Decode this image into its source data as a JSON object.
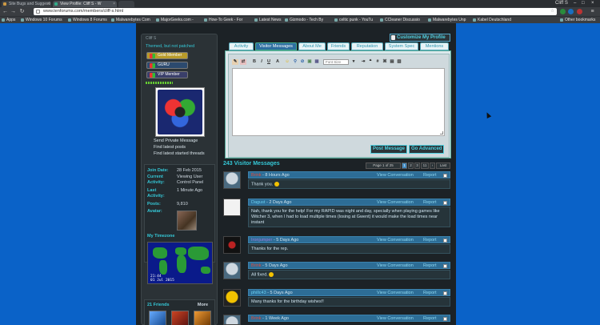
{
  "browser": {
    "tabs": [
      {
        "label": "Site Bugs and Suggesti"
      },
      {
        "label": "View Profile: Cliff S - W"
      },
      {
        "label": ""
      }
    ],
    "window_controls": "Cliff S",
    "url": "www.tenforums.com/members/cliff-s.html",
    "bookmarks": [
      {
        "label": "Apps"
      },
      {
        "label": "Windows 10 Forums"
      },
      {
        "label": "Windows 8 Forums"
      },
      {
        "label": "Malwarebytes Com"
      },
      {
        "label": "MajorGeeks.com -"
      },
      {
        "label": "How-To Geek - For"
      },
      {
        "label": "Latest News"
      },
      {
        "label": "Gizmodo - Tech By"
      },
      {
        "label": "celtic punk - YouTu"
      },
      {
        "label": "CCleaner Discussio"
      },
      {
        "label": "Malwarebytes Unp"
      },
      {
        "label": "Kabel Deutschland"
      },
      {
        "label": "Other bookmarks"
      }
    ]
  },
  "profile": {
    "username": "Cliff S",
    "status": "Themed, but not patched",
    "badges": [
      "Gold Member",
      "GURU",
      "VIP Member"
    ],
    "links": [
      "Send Private Message",
      "Find latest posts",
      "Find latest started threads"
    ],
    "info": {
      "join_label": "Join Date:",
      "join_value": "28 Feb 2015",
      "activity_label": "Current Activity:",
      "activity_value": "Viewing User Control Panel",
      "last_label": "Last Activity:",
      "last_value": "1 Minute Ago",
      "posts_label": "Posts:",
      "posts_value": "9,810",
      "avatar_label": "Avatar:"
    },
    "timezone_label": "My Timezone",
    "clock_time": "21:44",
    "clock_date": "01 Jul 2015",
    "friends_label": "21 Friends",
    "friends_more": "More"
  },
  "customize_label": "Customize My Profile",
  "tabs": [
    "Activity",
    "Visitor Messages",
    "About Me",
    "Friends",
    "Reputation",
    "System Spec",
    "Mentions"
  ],
  "editor": {
    "font_placeholder": "Font Size",
    "post_button": "Post Message",
    "advanced_button": "Go Advanced"
  },
  "visitor_header": "243 Visitor Messages",
  "pager": {
    "info": "Page 1 of 25",
    "pages": [
      "1",
      "2",
      "3",
      "11"
    ],
    "last": "Last"
  },
  "messages": [
    {
      "author": "Brink",
      "time": "8 Hours Ago",
      "body": "Thank you.",
      "smiley": true,
      "conv": "View Conversation",
      "report": "Report"
    },
    {
      "author": "Dagust",
      "time": "2 Days Ago",
      "body": "Nah, thank you for the help! For my RAPID was night and day, specially when playing games like Witcher 3, when I had to load multiple times (losing at Gwent) it would make the load times near instant",
      "smiley": false,
      "conv": "View Conversation",
      "report": "Report"
    },
    {
      "author": "Ironjumper",
      "time": "5 Days Ago",
      "body": "Thanks for the rep.",
      "smiley": false,
      "conv": "View Conversation",
      "report": "Report"
    },
    {
      "author": "Brink",
      "time": "5 Days Ago",
      "body": "All fixed.",
      "smiley": true,
      "conv": "View Conversation",
      "report": "Report"
    },
    {
      "author": "phillc43",
      "time": "5 Days Ago",
      "body": "Many thanks for the birthday wishes!!",
      "smiley": false,
      "conv": "View Conversation",
      "report": "Report"
    },
    {
      "author": "Brink",
      "time": "1 Week Ago",
      "body": "",
      "smiley": false,
      "conv": "View Conversation",
      "report": "Report"
    }
  ]
}
